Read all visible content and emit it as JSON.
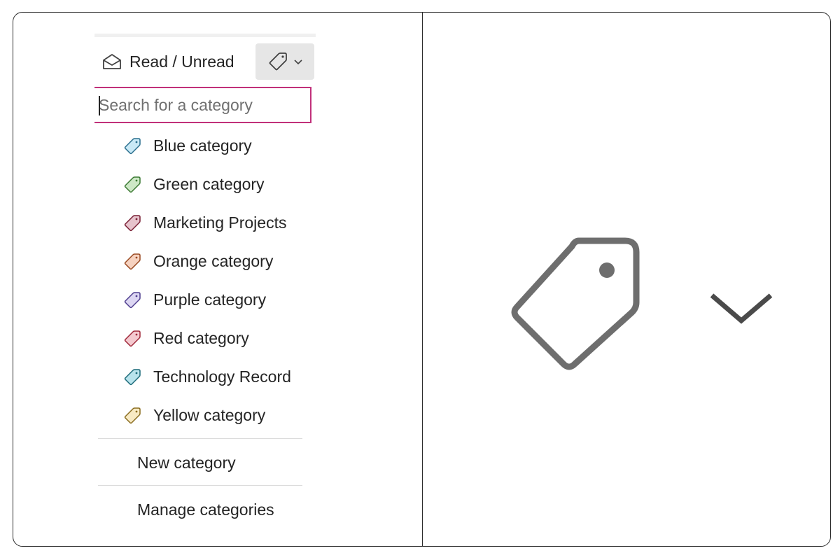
{
  "toolbar": {
    "read_unread_label": "Read / Unread",
    "read_unread_icon": "envelope-open-icon",
    "categorize_icon": "tag-icon",
    "categorize_dropdown_icon": "chevron-down-icon"
  },
  "search": {
    "placeholder": "Search for a category",
    "value": ""
  },
  "categories": [
    {
      "label": "Blue category",
      "fill": "#c9e9f6",
      "stroke": "#2a6f8e"
    },
    {
      "label": "Green category",
      "fill": "#cde8c6",
      "stroke": "#3c7a33"
    },
    {
      "label": "Marketing Projects",
      "fill": "#e6c3cc",
      "stroke": "#7a2036"
    },
    {
      "label": "Orange category",
      "fill": "#f6d2c0",
      "stroke": "#9a4a22"
    },
    {
      "label": "Purple category",
      "fill": "#dcd6f2",
      "stroke": "#4f3f8f"
    },
    {
      "label": "Red category",
      "fill": "#f4c9cf",
      "stroke": "#a0283a"
    },
    {
      "label": "Technology Record",
      "fill": "#b8e3ec",
      "stroke": "#1d6b7a"
    },
    {
      "label": "Yellow category",
      "fill": "#f8eac4",
      "stroke": "#8a6d1f"
    }
  ],
  "actions": {
    "new_category": "New category",
    "manage_categories": "Manage categories"
  },
  "colors": {
    "accent": "#c1307a",
    "button_bg": "#e6e6e6",
    "icon_gray": "#6e6e6e"
  }
}
